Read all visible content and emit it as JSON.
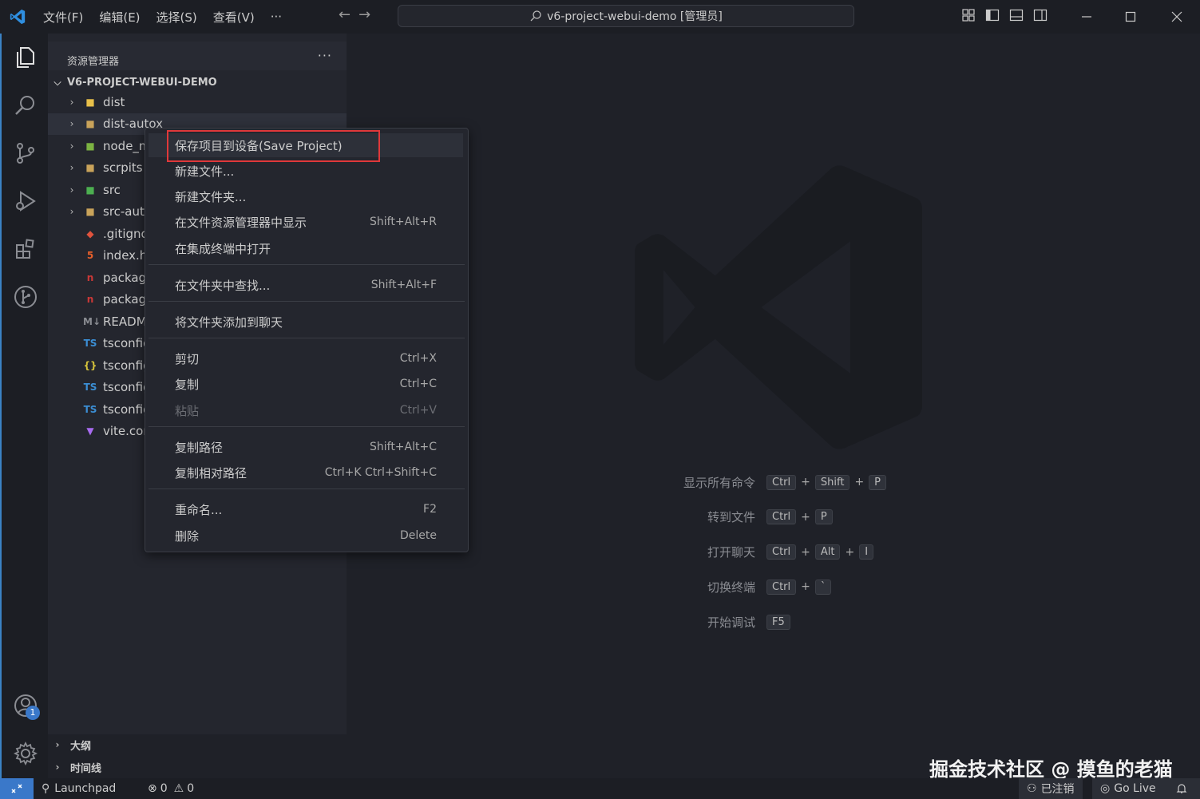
{
  "titlebar": {
    "menu": [
      "文件(F)",
      "编辑(E)",
      "选择(S)",
      "查看(V)",
      "···"
    ],
    "search_text": "v6-project-webui-demo [管理员]",
    "back_arrow": "←",
    "forward_arrow": "→"
  },
  "sidebar": {
    "title": "资源管理器",
    "more": "···",
    "project": "V6-PROJECT-WEBUI-DEMO",
    "items": [
      {
        "label": "dist",
        "icon": "folder-dist-icon"
      },
      {
        "label": "dist-autox",
        "icon": "folder-icon"
      },
      {
        "label": "node_modules",
        "icon": "folder-node-icon"
      },
      {
        "label": "scrpits",
        "icon": "folder-icon"
      },
      {
        "label": "src",
        "icon": "folder-src-icon"
      },
      {
        "label": "src-autox",
        "icon": "folder-icon"
      },
      {
        "label": ".gitignore",
        "icon": "git-icon"
      },
      {
        "label": "index.html",
        "icon": "html5-icon"
      },
      {
        "label": "package.json",
        "icon": "npm-icon"
      },
      {
        "label": "package-lock.json",
        "icon": "npm-icon"
      },
      {
        "label": "README.md",
        "icon": "markdown-icon"
      },
      {
        "label": "tsconfig.app.json",
        "icon": "typescript-icon"
      },
      {
        "label": "tsconfig.json",
        "icon": "json-braces-icon"
      },
      {
        "label": "tsconfig.node.json",
        "icon": "typescript-icon"
      },
      {
        "label": "tsconfig.vitest.json",
        "icon": "typescript-icon"
      },
      {
        "label": "vite.config.ts",
        "icon": "vite-icon"
      }
    ],
    "outline": "大纲",
    "timeline": "时间线"
  },
  "context_menu": {
    "groups": [
      [
        {
          "label": "保存项目到设备(Save Project)",
          "shortcut": ""
        },
        {
          "label": "新建文件...",
          "shortcut": ""
        },
        {
          "label": "新建文件夹...",
          "shortcut": ""
        },
        {
          "label": "在文件资源管理器中显示",
          "shortcut": "Shift+Alt+R"
        },
        {
          "label": "在集成终端中打开",
          "shortcut": ""
        }
      ],
      [
        {
          "label": "在文件夹中查找...",
          "shortcut": "Shift+Alt+F"
        }
      ],
      [
        {
          "label": "将文件夹添加到聊天",
          "shortcut": ""
        }
      ],
      [
        {
          "label": "剪切",
          "shortcut": "Ctrl+X"
        },
        {
          "label": "复制",
          "shortcut": "Ctrl+C"
        },
        {
          "label": "粘贴",
          "shortcut": "Ctrl+V",
          "disabled": true
        }
      ],
      [
        {
          "label": "复制路径",
          "shortcut": "Shift+Alt+C"
        },
        {
          "label": "复制相对路径",
          "shortcut": "Ctrl+K Ctrl+Shift+C"
        }
      ],
      [
        {
          "label": "重命名...",
          "shortcut": "F2"
        },
        {
          "label": "删除",
          "shortcut": "Delete"
        }
      ]
    ]
  },
  "editor_hints": [
    {
      "label": "显示所有命令",
      "keys": [
        "Ctrl",
        "Shift",
        "P"
      ]
    },
    {
      "label": "转到文件",
      "keys": [
        "Ctrl",
        "P"
      ]
    },
    {
      "label": "打开聊天",
      "keys": [
        "Ctrl",
        "Alt",
        "I"
      ]
    },
    {
      "label": "切换终端",
      "keys": [
        "Ctrl",
        "`"
      ]
    },
    {
      "label": "开始调试",
      "keys": [
        "F5"
      ]
    }
  ],
  "watermark": "掘金技术社区 @ 摸鱼的老猫",
  "statusbar": {
    "launchpad": "Launchpad",
    "errors": "0",
    "warnings": "0",
    "account": "已注销",
    "golive": "Go Live"
  },
  "accounts_badge": "1",
  "colors": {
    "background": "#1f2128",
    "sidebar": "#24262e",
    "accent": "#3a78c9",
    "highlight_box": "#e0383a"
  }
}
